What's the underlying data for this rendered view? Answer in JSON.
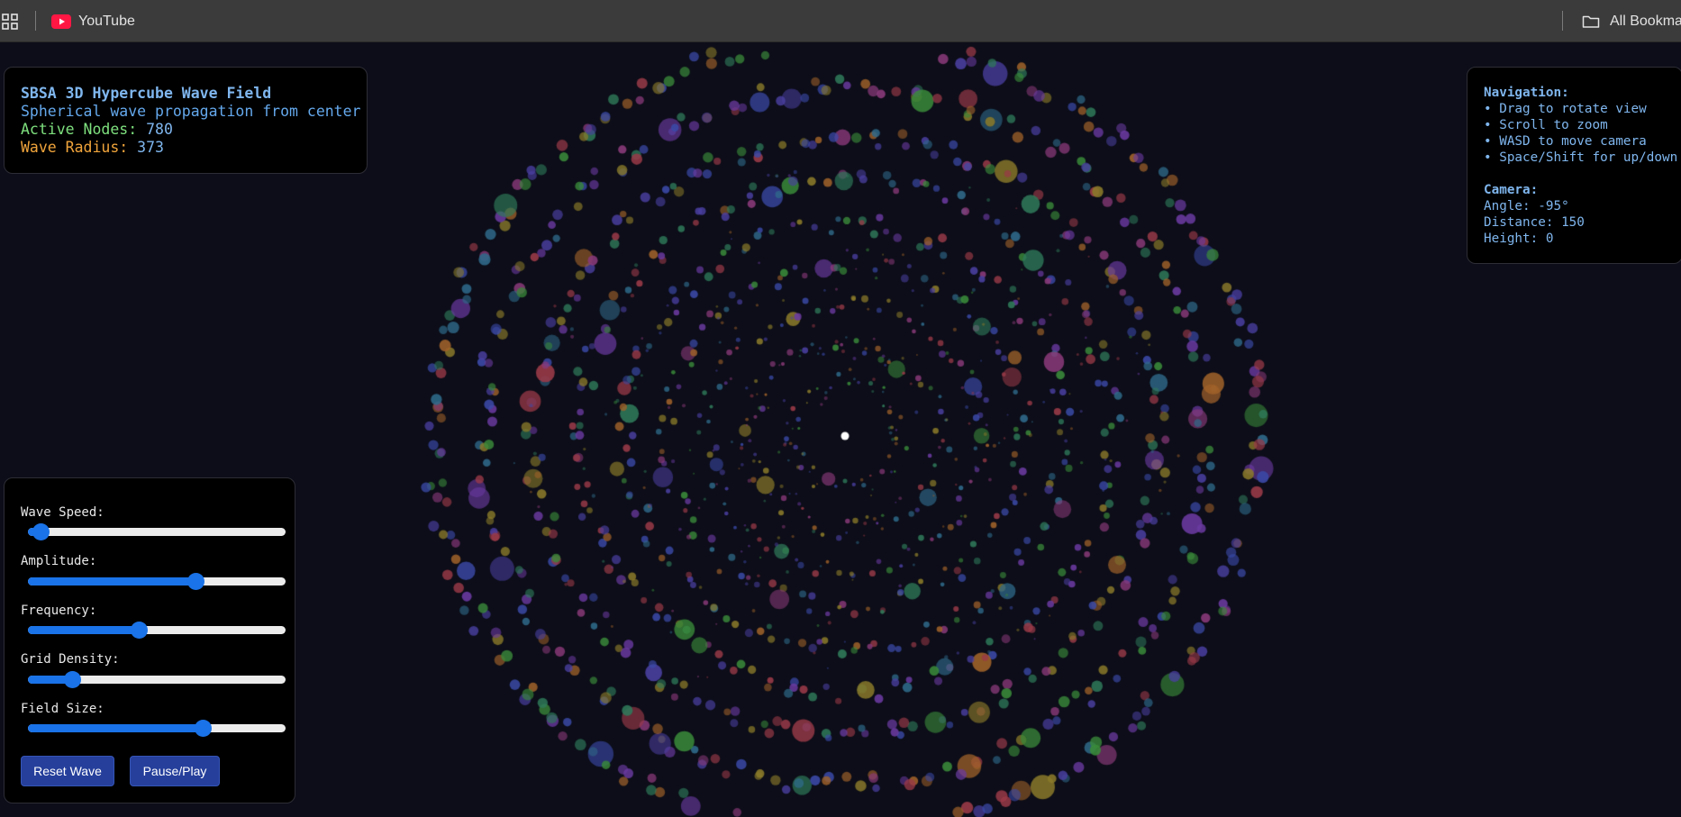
{
  "bookmarks_bar": {
    "items": [
      {
        "label": "YouTube",
        "icon": "youtube-icon"
      }
    ],
    "all_bookmarks_label": "All Bookmar",
    "icons": {
      "apps": "apps-grid-icon",
      "folder": "folder-icon"
    }
  },
  "info_panel": {
    "title": "SBSA 3D Hypercube Wave Field",
    "subtitle": "Spherical wave propagation from center",
    "active_nodes_label": "Active Nodes:",
    "active_nodes_value": "780",
    "wave_radius_label": "Wave Radius:",
    "wave_radius_value": "373"
  },
  "nav_panel": {
    "navigation_heading": "Navigation:",
    "instructions": [
      "• Drag to rotate view",
      "• Scroll to zoom",
      "• WASD to move camera",
      "• Space/Shift for up/down"
    ],
    "camera_heading": "Camera:",
    "camera_angle": "Angle: -95°",
    "camera_distance": "Distance: 150",
    "camera_height": "Height: 0"
  },
  "controls": {
    "sliders": [
      {
        "label": "Wave Speed:",
        "value": 0.05
      },
      {
        "label": "Amplitude:",
        "value": 0.65
      },
      {
        "label": "Frequency:",
        "value": 0.43
      },
      {
        "label": "Grid Density:",
        "value": 0.17
      },
      {
        "label": "Field Size:",
        "value": 0.68
      }
    ],
    "reset_label": "Reset Wave",
    "pause_label": "Pause/Play"
  },
  "field": {
    "background": "#0c0d18",
    "particle_colors": [
      "#3b4aa8",
      "#4a3fa0",
      "#2f7a5a",
      "#3a8a3a",
      "#8a3a7a",
      "#9a3a48",
      "#8a7a2a",
      "#a0622a",
      "#2f6a8a",
      "#6a3aa0"
    ],
    "center_color": "#ffffff"
  },
  "colors": {
    "accent": "#1a73e8",
    "button_bg": "#253f9b"
  }
}
